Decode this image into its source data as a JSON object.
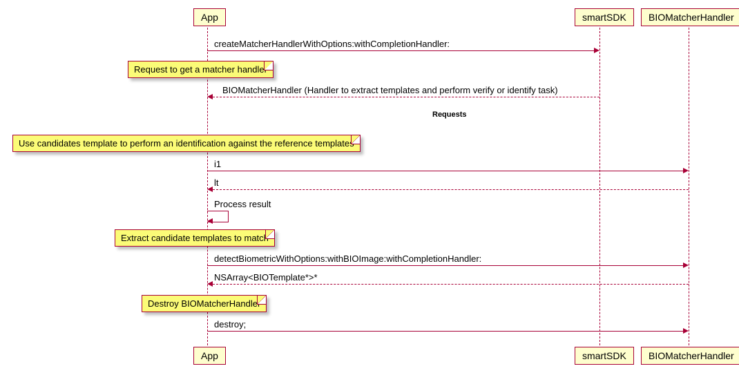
{
  "participants": {
    "app": "App",
    "smartSDK": "smartSDK",
    "bioHandler": "BIOMatcherHandler"
  },
  "messages": {
    "createHandler": "createMatcherHandlerWithOptions:withCompletionHandler:",
    "returnHandler": "BIOMatcherHandler (Handler to extract templates and perform verify or identify task)",
    "groupRequests": "Requests",
    "i1": "i1",
    "lt": "lt",
    "processResult": "Process result",
    "detectBiometric": "detectBiometricWithOptions:withBIOImage:withCompletionHandler:",
    "nsArray": "NSArray<BIOTemplate*>*",
    "destroy": "destroy;"
  },
  "notes": {
    "requestHandler": "Request to get a matcher handler",
    "useCandidates": "Use candidates template to perform an identification against the reference templates",
    "extractCandidates": "Extract candidate templates to match",
    "destroyHandler": "Destroy BIOMatcherHandler"
  },
  "chart_data": {
    "type": "sequence-diagram",
    "participants": [
      "App",
      "smartSDK",
      "BIOMatcherHandler"
    ],
    "interactions": [
      {
        "from": "App",
        "to": "smartSDK",
        "type": "sync",
        "label": "createMatcherHandlerWithOptions:withCompletionHandler:"
      },
      {
        "note": "Request to get a matcher handler",
        "attached": "App"
      },
      {
        "from": "smartSDK",
        "to": "App",
        "type": "return",
        "label": "BIOMatcherHandler (Handler to extract templates and perform verify or identify task)"
      },
      {
        "group": "Requests"
      },
      {
        "note": "Use candidates template to perform an identification against the reference templates",
        "attached": "App"
      },
      {
        "from": "App",
        "to": "BIOMatcherHandler",
        "type": "sync",
        "label": "i1"
      },
      {
        "from": "BIOMatcherHandler",
        "to": "App",
        "type": "return",
        "label": "lt"
      },
      {
        "from": "App",
        "to": "App",
        "type": "self",
        "label": "Process result"
      },
      {
        "note": "Extract candidate templates to match",
        "attached": "App"
      },
      {
        "from": "App",
        "to": "BIOMatcherHandler",
        "type": "sync",
        "label": "detectBiometricWithOptions:withBIOImage:withCompletionHandler:"
      },
      {
        "from": "BIOMatcherHandler",
        "to": "App",
        "type": "return",
        "label": "NSArray<BIOTemplate*>*"
      },
      {
        "note": "Destroy BIOMatcherHandler",
        "attached": "App"
      },
      {
        "from": "App",
        "to": "BIOMatcherHandler",
        "type": "sync",
        "label": "destroy;"
      }
    ]
  }
}
